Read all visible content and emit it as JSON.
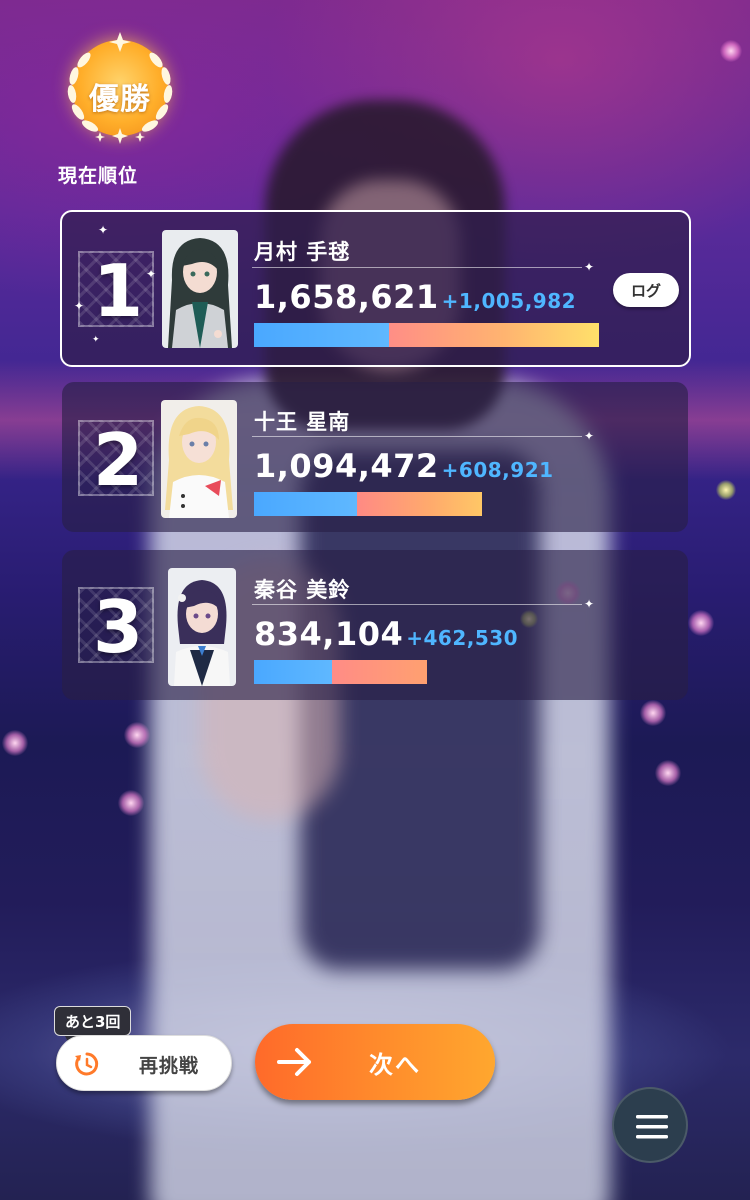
{
  "header": {
    "trophy_label": "優勝",
    "rank_caption": "現在順位"
  },
  "rankings": [
    {
      "rank": "1",
      "name": "月村 手毬",
      "score": "1,658,621",
      "delta": "+1,005,982",
      "bar_blue_fraction": 0.39,
      "bar_total_fraction": 1.0
    },
    {
      "rank": "2",
      "name": "十王 星南",
      "score": "1,094,472",
      "delta": "+608,921",
      "bar_blue_fraction": 0.45,
      "bar_total_fraction": 0.66
    },
    {
      "rank": "3",
      "name": "秦谷 美鈴",
      "score": "834,104",
      "delta": "+462,530",
      "bar_blue_fraction": 0.45,
      "bar_total_fraction": 0.5
    }
  ],
  "log_button": "ログ",
  "controls": {
    "remaining": "あと3回",
    "retry": "再挑戦",
    "next": "次へ"
  },
  "colors": {
    "bar_blue": "#4aa8ff",
    "delta_blue": "#4fb6ff",
    "next_orange": "#ff8a2c",
    "retry_icon": "#ff7a2a"
  },
  "icons": {
    "retry": "retry-clock-icon",
    "next": "arrow-right-icon",
    "menu": "hamburger-menu-icon",
    "trophy": "laurel-wreath-icon"
  }
}
